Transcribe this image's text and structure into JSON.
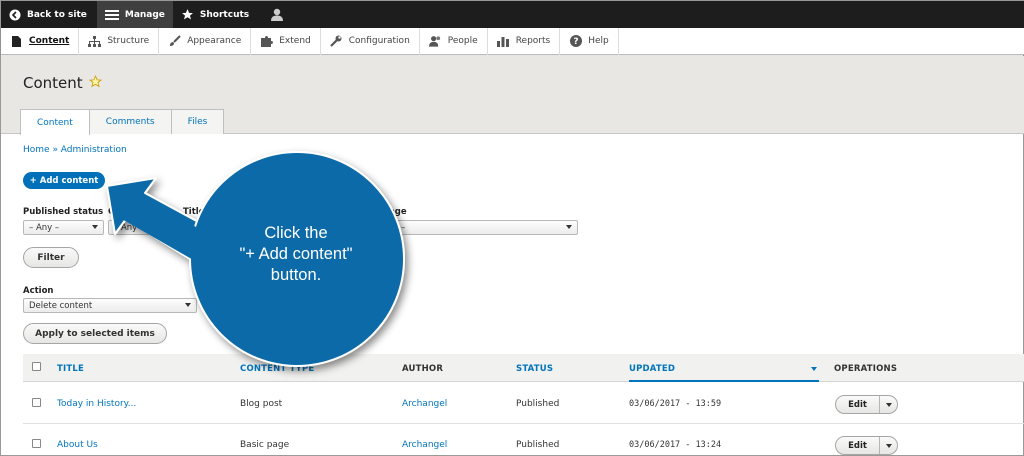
{
  "toolbar": {
    "back_label": "Back to site",
    "manage_label": "Manage",
    "shortcuts_label": "Shortcuts"
  },
  "tray": {
    "items": [
      {
        "label": "Content",
        "icon": "page-icon"
      },
      {
        "label": "Structure",
        "icon": "sitemap-icon"
      },
      {
        "label": "Appearance",
        "icon": "brush-icon"
      },
      {
        "label": "Extend",
        "icon": "puzzle-icon"
      },
      {
        "label": "Configuration",
        "icon": "wrench-icon"
      },
      {
        "label": "People",
        "icon": "people-icon"
      },
      {
        "label": "Reports",
        "icon": "bar-chart-icon"
      },
      {
        "label": "Help",
        "icon": "help-icon"
      }
    ]
  },
  "page": {
    "title": "Content",
    "tabs": [
      "Content",
      "Comments",
      "Files"
    ],
    "active_tab": "Content"
  },
  "breadcrumb": "Home » Administration",
  "add_button": "+ Add content",
  "filters": {
    "published_status_label": "Published status",
    "published_status_value": "– Any –",
    "content_type_label": "Co",
    "content_type_value": "– Any –",
    "title_label": "Title",
    "language_label": "uage",
    "language_value": "–",
    "filter_button": "Filter"
  },
  "action": {
    "label": "Action",
    "value": "Delete content",
    "apply_button": "Apply to selected items"
  },
  "table": {
    "headers": {
      "title": "TITLE",
      "content_type": "CONTENT TYPE",
      "author": "AUTHOR",
      "status": "STATUS",
      "updated": "UPDATED",
      "operations": "OPERATIONS"
    },
    "rows": [
      {
        "title": "Today in History...",
        "type": "Blog post",
        "author": "Archangel",
        "status": "Published",
        "updated": "03/06/2017 - 13:59",
        "op": "Edit"
      },
      {
        "title": "About Us",
        "type": "Basic page",
        "author": "Archangel",
        "status": "Published",
        "updated": "03/06/2017 - 13:24",
        "op": "Edit"
      }
    ]
  },
  "callout": {
    "line1": "Click the",
    "line2": "\"+ Add content\"",
    "line3": "button.",
    "color": "#0b6aa8"
  },
  "colors": {
    "link": "#0074bd",
    "primary_button": "#0071b8",
    "toolbar": "#1d1d1d",
    "header_bg": "#e8e7e3"
  }
}
